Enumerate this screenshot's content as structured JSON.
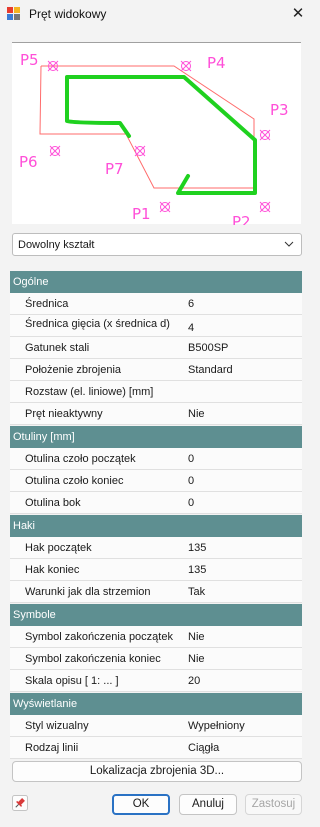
{
  "window": {
    "title": "Pręt widokowy"
  },
  "preview": {
    "points": [
      "P1",
      "P2",
      "P3",
      "P4",
      "P5",
      "P6",
      "P7"
    ]
  },
  "shape_select": {
    "value": "Dowolny kształt"
  },
  "groups": [
    {
      "title": "Ogólne",
      "rows": [
        {
          "label": "Średnica",
          "value": "6"
        },
        {
          "label": "Średnica gięcia (x średnica d)",
          "value": "4"
        },
        {
          "label": "Gatunek stali",
          "value": "B500SP"
        },
        {
          "label": "Położenie zbrojenia",
          "value": "Standard"
        },
        {
          "label": "Rozstaw (el. liniowe) [mm]",
          "value": ""
        },
        {
          "label": "Pręt nieaktywny",
          "value": "Nie"
        }
      ]
    },
    {
      "title": "Otuliny [mm]",
      "rows": [
        {
          "label": "Otulina czoło początek",
          "value": "0"
        },
        {
          "label": "Otulina czoło koniec",
          "value": "0"
        },
        {
          "label": "Otulina bok",
          "value": "0"
        }
      ]
    },
    {
      "title": "Haki",
      "rows": [
        {
          "label": "Hak początek",
          "value": "135"
        },
        {
          "label": "Hak koniec",
          "value": "135"
        },
        {
          "label": "Warunki jak dla strzemion",
          "value": "Tak"
        }
      ]
    },
    {
      "title": "Symbole",
      "rows": [
        {
          "label": "Symbol zakończenia początek",
          "value": "Nie"
        },
        {
          "label": "Symbol zakończenia koniec",
          "value": "Nie"
        },
        {
          "label": "Skala opisu [ 1: ... ]",
          "value": "20"
        }
      ]
    },
    {
      "title": "Wyświetlanie",
      "rows": [
        {
          "label": "Styl wizualny",
          "value": "Wypełniony"
        },
        {
          "label": "Rodzaj linii",
          "value": "Ciągła"
        }
      ]
    }
  ],
  "buttons": {
    "location": "Lokalizacja zbrojenia 3D...",
    "ok": "OK",
    "cancel": "Anuluj",
    "apply": "Zastosuj"
  },
  "colors": {
    "group_header": "#5e8f91",
    "rebar": "#1fd11f",
    "points": "#ff4fd8",
    "outline": "#ff6b6b"
  }
}
